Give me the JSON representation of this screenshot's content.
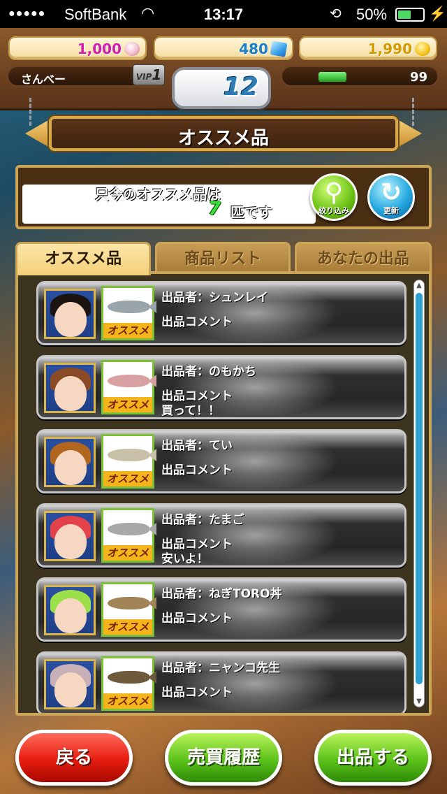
{
  "status_bar": {
    "signal": "●●●●●",
    "carrier": "SoftBank",
    "time": "13:17",
    "battery_percent": "50%",
    "battery_level": 0.5
  },
  "header": {
    "pearls": "1,000",
    "gems": "480",
    "coins": "1,990",
    "player_name": "さんべー",
    "vip_label": "VIP",
    "vip_level": "1",
    "level": "12",
    "stamina": "99"
  },
  "title": "オススメ品",
  "info": {
    "line1": "只今のオススメ品は",
    "count": "7",
    "unit": "匹です",
    "filter_label": "絞り込み",
    "refresh_label": "更新"
  },
  "tabs": [
    {
      "label": "オススメ品",
      "active": true
    },
    {
      "label": "商品リスト",
      "active": false
    },
    {
      "label": "あなたの出品",
      "active": false
    }
  ],
  "listings": [
    {
      "seller": "出品者：シュンレイ",
      "comment": "出品コメント",
      "tag": "オススメ",
      "hair": "#1b1410",
      "fish": "#9aa5aa"
    },
    {
      "seller": "出品者：のもかち",
      "comment": "出品コメント\n買って！！",
      "tag": "オススメ",
      "hair": "#8a4a25",
      "fish": "#d8a0a0"
    },
    {
      "seller": "出品者：てい",
      "comment": "出品コメント",
      "tag": "オススメ",
      "hair": "#b0661e",
      "fish": "#c9c0a8"
    },
    {
      "seller": "出品者：たまご",
      "comment": "出品コメント\n安いよ！",
      "tag": "オススメ",
      "hair": "#e3424a",
      "fish": "#a8a8a8"
    },
    {
      "seller": "出品者：ねぎTORO丼",
      "comment": "出品コメント",
      "tag": "オススメ",
      "hair": "#9be04a",
      "fish": "#a08455"
    },
    {
      "seller": "出品者：ニャンコ先生",
      "comment": "出品コメント",
      "tag": "オススメ",
      "hair": "#c7b0b8",
      "fish": "#6d5a3a"
    }
  ],
  "buttons": {
    "back": "戻る",
    "history": "売買履歴",
    "sell": "出品する"
  }
}
